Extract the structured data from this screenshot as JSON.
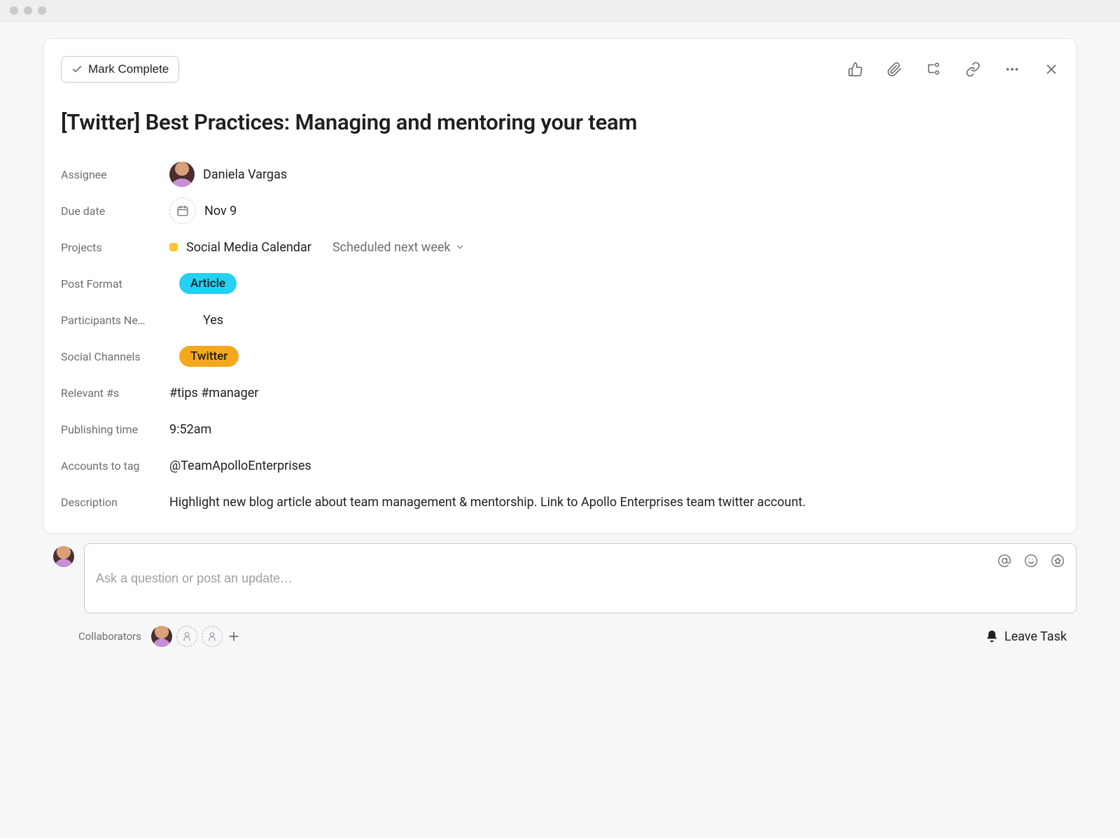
{
  "chrome": {},
  "header": {
    "mark_complete_label": "Mark Complete"
  },
  "task": {
    "title": "[Twitter] Best Practices: Managing and mentoring your team",
    "labels": {
      "assignee": "Assignee",
      "due_date": "Due date",
      "projects": "Projects",
      "post_format": "Post Format",
      "participants": "Participants Ne…",
      "social_channels": "Social Channels",
      "hashtags": "Relevant #s",
      "publishing_time": "Publishing time",
      "accounts_to_tag": "Accounts to tag",
      "description": "Description"
    },
    "assignee_name": "Daniela Vargas",
    "due_date_value": "Nov 9",
    "project": {
      "name": "Social Media Calendar",
      "section": "Scheduled next week",
      "color": "#ffc233"
    },
    "post_format": "Article",
    "participants_value": "Yes",
    "social_channel": "Twitter",
    "hashtags_value": "#tips #manager",
    "publishing_time_value": "9:52am",
    "accounts_to_tag_value": "@TeamApolloEnterprises",
    "description_value": "Highlight new blog article about team management & mentorship. Link to Apollo Enterprises team twitter account."
  },
  "composer": {
    "placeholder": "Ask a question or post an update…"
  },
  "footer": {
    "collaborators_label": "Collaborators",
    "leave_task_label": "Leave Task"
  }
}
